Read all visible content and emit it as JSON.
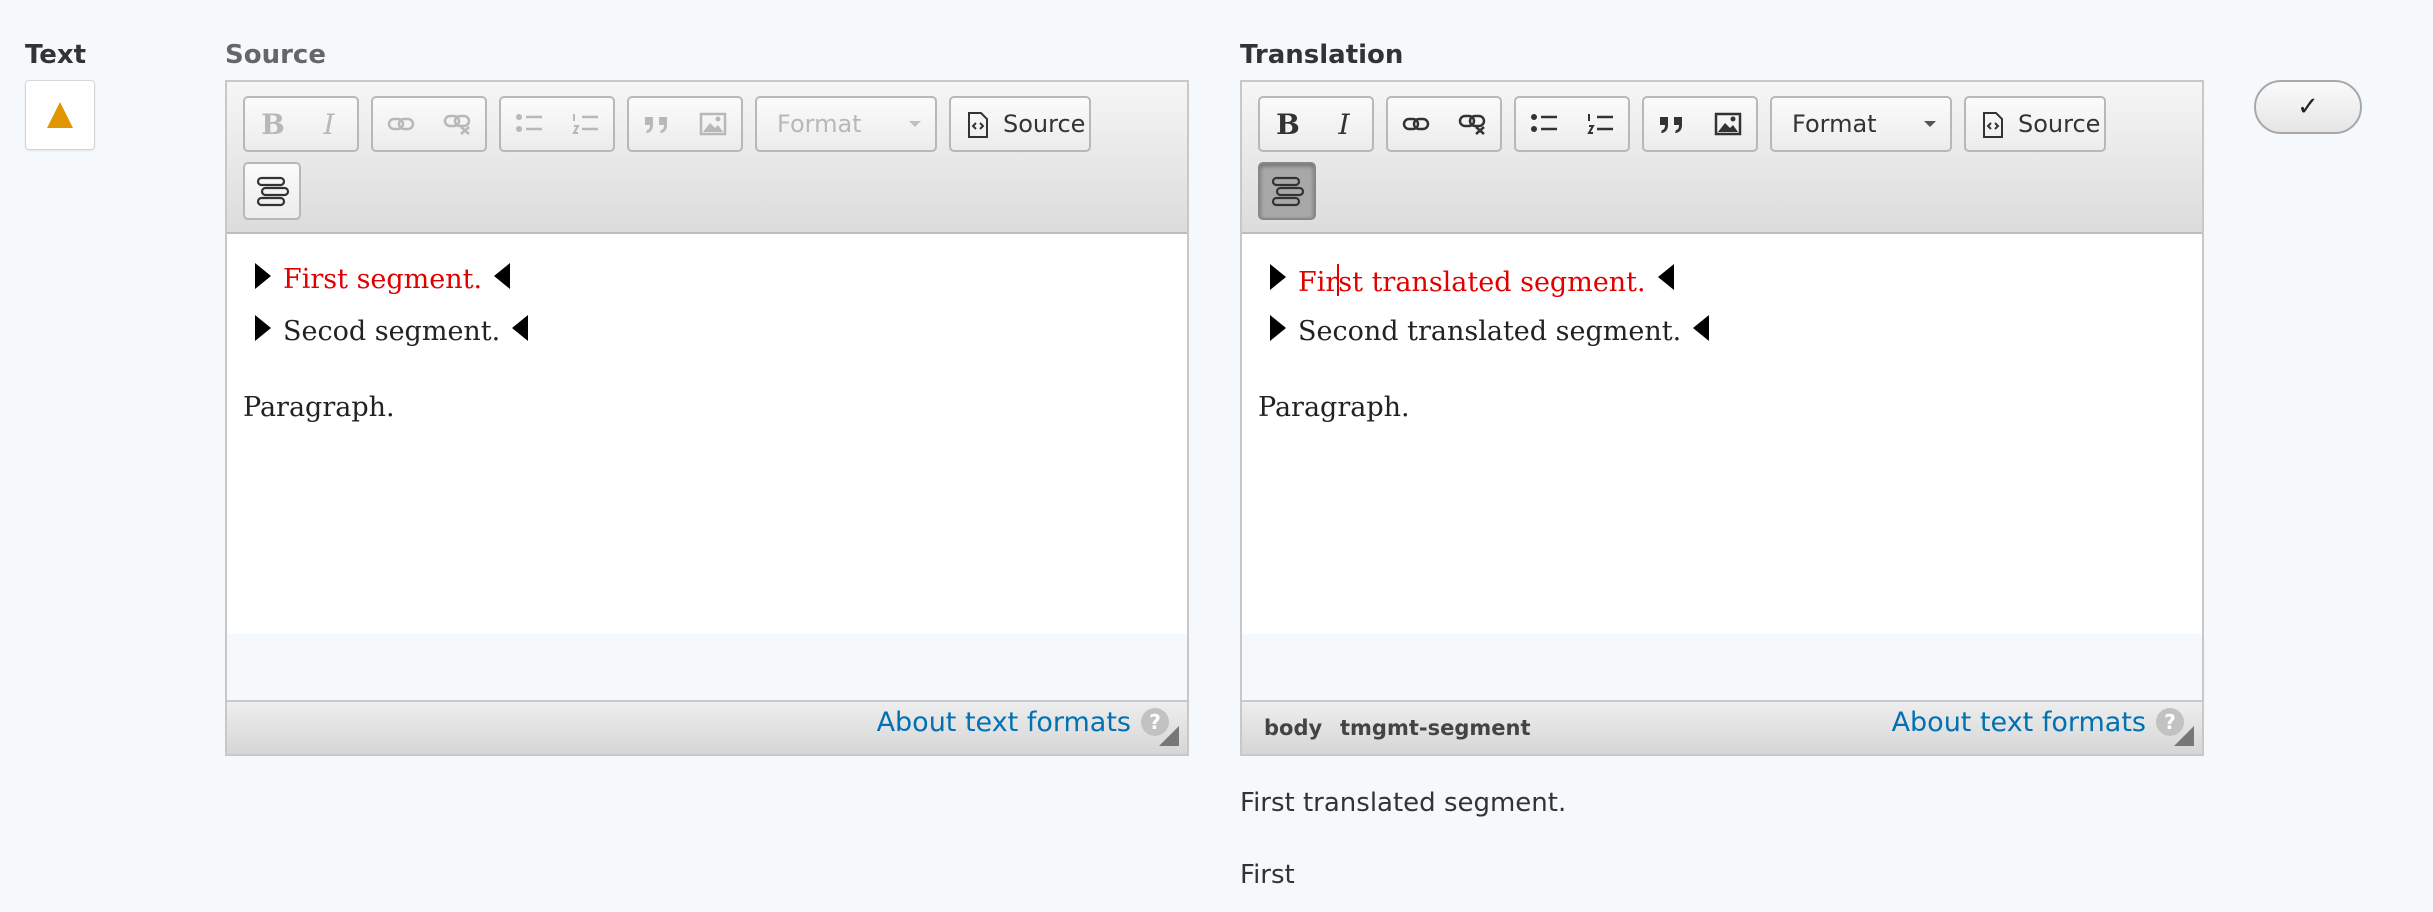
{
  "field": {
    "label": "Text"
  },
  "source_column": {
    "label": "Source",
    "toolbar": {
      "format_label": "Format",
      "source_label": "Source",
      "bold": "B",
      "italic": "I"
    },
    "segments": [
      {
        "text": "First segment.",
        "highlighted": true
      },
      {
        "text": "Secod segment.",
        "highlighted": false
      }
    ],
    "paragraph": "Paragraph.",
    "about_link": "About text formats"
  },
  "translation_column": {
    "label": "Translation",
    "toolbar": {
      "format_label": "Format",
      "source_label": "Source",
      "bold": "B",
      "italic": "I"
    },
    "segments": [
      {
        "text_before_cursor": "Fir",
        "text_after_cursor": "st translated segment.",
        "highlighted": true
      },
      {
        "text": "Second translated segment.",
        "highlighted": false
      }
    ],
    "paragraph": "Paragraph.",
    "path": [
      "body",
      "tmgmt-segment"
    ],
    "about_link": "About text formats",
    "suggestions": [
      "First translated segment.",
      "First"
    ]
  },
  "confirm_button": {
    "label": "✓"
  },
  "help_label": "?",
  "colors": {
    "warning": "#e09600",
    "link": "#0071b3",
    "highlight": "#e00000"
  },
  "icons": [
    "warning-icon",
    "link-icon",
    "unlink-icon",
    "bulleted-list-icon",
    "numbered-list-icon",
    "blockquote-icon",
    "image-icon",
    "source-code-icon",
    "segment-icon",
    "resize-grip-icon",
    "help-icon",
    "check-icon"
  ]
}
